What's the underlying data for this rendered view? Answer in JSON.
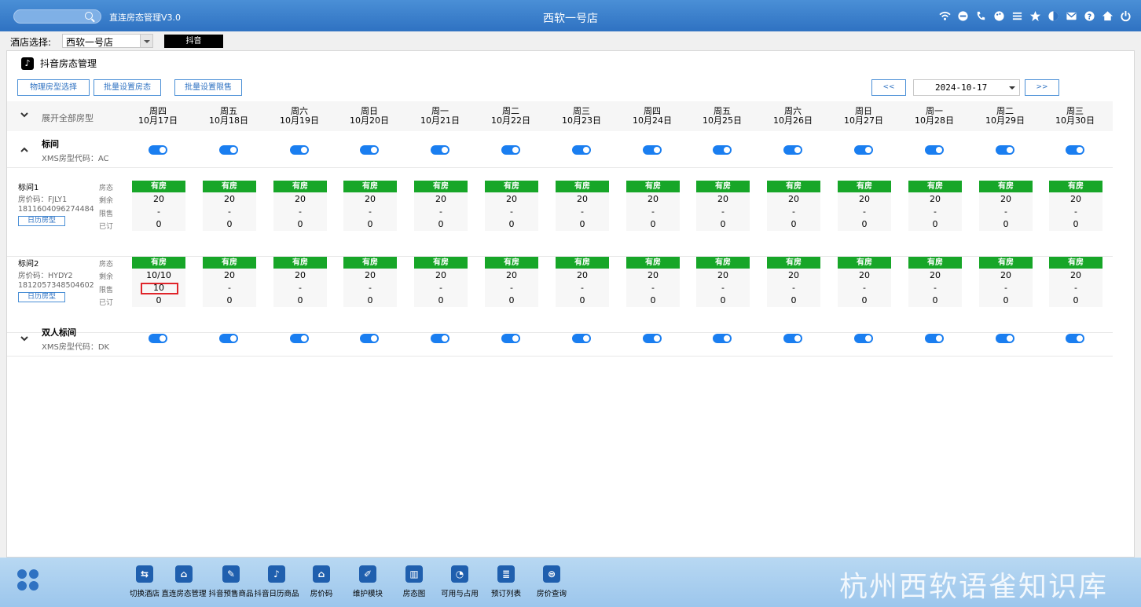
{
  "titlebar": {
    "app_title": "直连房态管理V3.0",
    "hotel_name": "西软一号店",
    "icons": [
      "wifi-icon",
      "chat-icon",
      "phone-icon",
      "palette-icon",
      "menu-icon",
      "star-icon",
      "theme-icon",
      "mail-icon",
      "help-icon",
      "home-icon",
      "power-icon"
    ]
  },
  "selector": {
    "label": "酒店选择:",
    "value": "西软一号店",
    "platform_button": "抖音"
  },
  "page": {
    "title": "抖音房态管理",
    "logo_glyph": "♪",
    "actions": [
      "物理房型选择",
      "批量设置房态",
      "批量设置限售"
    ],
    "prev": "<<",
    "next": ">>",
    "date": "2024-10-17"
  },
  "header": {
    "expand_label": "展开全部房型",
    "days": [
      {
        "weekday": "周四",
        "date": "10月17日"
      },
      {
        "weekday": "周五",
        "date": "10月18日"
      },
      {
        "weekday": "周六",
        "date": "10月19日"
      },
      {
        "weekday": "周日",
        "date": "10月20日"
      },
      {
        "weekday": "周一",
        "date": "10月21日"
      },
      {
        "weekday": "周二",
        "date": "10月22日"
      },
      {
        "weekday": "周三",
        "date": "10月23日"
      },
      {
        "weekday": "周四",
        "date": "10月24日"
      },
      {
        "weekday": "周五",
        "date": "10月25日"
      },
      {
        "weekday": "周六",
        "date": "10月26日"
      },
      {
        "weekday": "周日",
        "date": "10月27日"
      },
      {
        "weekday": "周一",
        "date": "10月28日"
      },
      {
        "weekday": "周二",
        "date": "10月29日"
      },
      {
        "weekday": "周三",
        "date": "10月30日"
      }
    ]
  },
  "room_types": [
    {
      "name": "标间",
      "code": "XMS房型代码：AC",
      "expanded": true
    },
    {
      "name": "双人标间",
      "code": "XMS房型代码：DK",
      "expanded": false
    }
  ],
  "row_labels": [
    "房态",
    "剩余",
    "限售",
    "已订"
  ],
  "rate_plans": [
    {
      "name": "标间1",
      "code": "房价码：FJLY1",
      "id": "1811604096274484",
      "calendar_button": "日历房型",
      "status": [
        "有房",
        "有房",
        "有房",
        "有房",
        "有房",
        "有房",
        "有房",
        "有房",
        "有房",
        "有房",
        "有房",
        "有房",
        "有房",
        "有房"
      ],
      "remaining": [
        "20",
        "20",
        "20",
        "20",
        "20",
        "20",
        "20",
        "20",
        "20",
        "20",
        "20",
        "20",
        "20",
        "20"
      ],
      "limit": [
        "-",
        "-",
        "-",
        "-",
        "-",
        "-",
        "-",
        "-",
        "-",
        "-",
        "-",
        "-",
        "-",
        "-"
      ],
      "booked": [
        "0",
        "0",
        "0",
        "0",
        "0",
        "0",
        "0",
        "0",
        "0",
        "0",
        "0",
        "0",
        "0",
        "0"
      ]
    },
    {
      "name": "标间2",
      "code": "房价码：HYDY2",
      "id": "1812057348504602",
      "calendar_button": "日历房型",
      "status": [
        "有房",
        "有房",
        "有房",
        "有房",
        "有房",
        "有房",
        "有房",
        "有房",
        "有房",
        "有房",
        "有房",
        "有房",
        "有房",
        "有房"
      ],
      "remaining": [
        "10/10",
        "20",
        "20",
        "20",
        "20",
        "20",
        "20",
        "20",
        "20",
        "20",
        "20",
        "20",
        "20",
        "20"
      ],
      "limit": [
        "10",
        "-",
        "-",
        "-",
        "-",
        "-",
        "-",
        "-",
        "-",
        "-",
        "-",
        "-",
        "-",
        "-"
      ],
      "booked": [
        "0",
        "0",
        "0",
        "0",
        "0",
        "0",
        "0",
        "0",
        "0",
        "0",
        "0",
        "0",
        "0",
        "0"
      ]
    }
  ],
  "toolbar": [
    {
      "label": "切换酒店",
      "glyph": "⇆",
      "icon": "switch-icon"
    },
    {
      "label": "直连房态管理",
      "glyph": "⌂",
      "icon": "house-gear-icon"
    },
    {
      "label": "抖音预售商品",
      "glyph": "✎",
      "icon": "presale-icon"
    },
    {
      "label": "抖音日历商品",
      "glyph": "♪",
      "icon": "douyin-icon"
    },
    {
      "label": "房价码",
      "glyph": "⌂",
      "icon": "home-icon"
    },
    {
      "label": "维护模块",
      "glyph": "✐",
      "icon": "wrench-icon"
    },
    {
      "label": "房态图",
      "glyph": "▥",
      "icon": "bank-icon"
    },
    {
      "label": "可用与占用",
      "glyph": "◔",
      "icon": "pie-icon"
    },
    {
      "label": "预订列表",
      "glyph": "≣",
      "icon": "list-icon"
    },
    {
      "label": "房价查询",
      "glyph": "⊜",
      "icon": "query-icon"
    }
  ],
  "watermark": "杭州西软语雀知识库"
}
